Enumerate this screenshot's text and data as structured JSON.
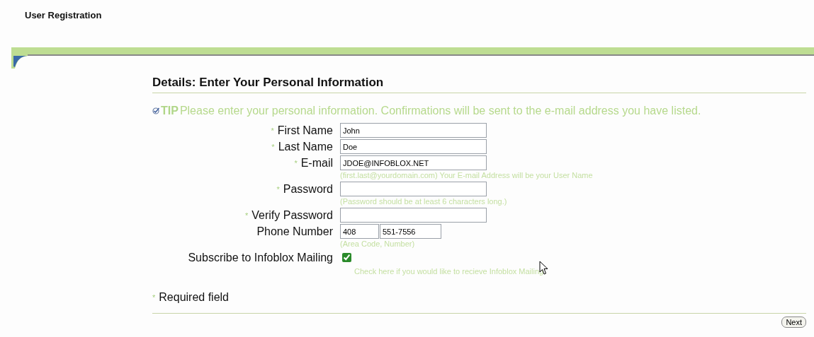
{
  "page_title": "User Registration",
  "section": {
    "title": "Details: Enter Your Personal Information"
  },
  "tip": {
    "label": "TIP",
    "text": "Please enter your personal information. Confirmations will be sent to the e-mail address you have listed."
  },
  "required_mark": "*",
  "fields": [
    {
      "kind": "text",
      "label": "First Name",
      "required": true,
      "value": "John"
    },
    {
      "kind": "text",
      "label": "Last Name",
      "required": true,
      "value": "Doe"
    },
    {
      "kind": "text",
      "label": "E-mail",
      "required": true,
      "value": "JDOE@INFOBLOX.NET",
      "hint": "(first.last@yourdomain.com) Your E-mail Address will be your User Name"
    },
    {
      "kind": "text",
      "label": "Password",
      "required": true,
      "hint": "(Password should be at least 6 characters long.)"
    },
    {
      "kind": "text",
      "label": "Verify Password",
      "required": true
    },
    {
      "kind": "phone",
      "label": "Phone Number",
      "required": false,
      "area_code": "408",
      "number": "551-7556",
      "hint": "(Area Code, Number)"
    },
    {
      "kind": "checkbox",
      "label": "Subscribe to Infoblox Mailing",
      "required": false,
      "checked": true,
      "hint": "Check here if you would like to recieve Infoblox Mailing"
    }
  ],
  "legend": {
    "text": "Required field"
  },
  "buttons": [
    {
      "label": "Next"
    }
  ]
}
